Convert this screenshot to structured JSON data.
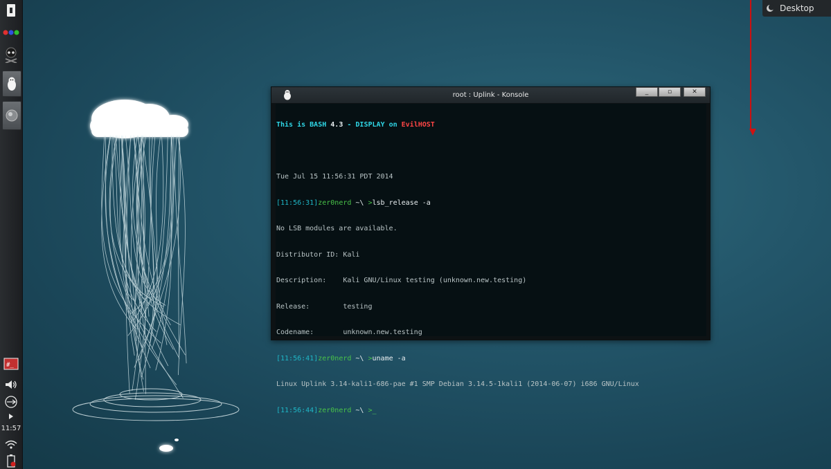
{
  "topright": {
    "label": "Desktop",
    "icon": "moon-icon"
  },
  "panel": {
    "clock": "11:57",
    "launchers": [
      "window-list-icon",
      "color-dots-icon",
      "skull-icon",
      "penguin-icon",
      "sphere-icon"
    ],
    "tray": [
      "terminal-icon",
      "volume-icon",
      "usb-icon",
      "arrow-right-icon",
      "wifi-icon",
      "battery-icon"
    ]
  },
  "window": {
    "title": "root : Uplink - Konsole",
    "buttons": [
      "minimize",
      "maximize",
      "close"
    ]
  },
  "terminal": {
    "banner": {
      "a": "This is BASH ",
      "b": "4.3",
      "c": " - DISPLAY on ",
      "d": "EvilHOST"
    },
    "date": "Tue Jul 15 11:56:31 PDT 2014",
    "prompt_user": "zer0nerd",
    "prompt_path": " ~\\ ",
    "prompt_char": ">",
    "cmd1_time": "[11:56:31]",
    "cmd1": "lsb_release -a",
    "out1": [
      "No LSB modules are available.",
      "Distributor ID: Kali",
      "Description:    Kali GNU/Linux testing (unknown.new.testing)",
      "Release:        testing",
      "Codename:       unknown.new.testing"
    ],
    "cmd2_time": "[11:56:41]",
    "cmd2": "uname -a",
    "out2": [
      "Linux Uplink 3.14-kali1-686-pae #1 SMP Debian 3.14.5-1kali1 (2014-06-07) i686 GNU/Linux"
    ],
    "cmd3_time": "[11:56:44]",
    "cursor": "_"
  },
  "colors": {
    "accent_red": "#cc1010",
    "terminal_cyan": "#2fd6e6",
    "terminal_green": "#49c249"
  }
}
